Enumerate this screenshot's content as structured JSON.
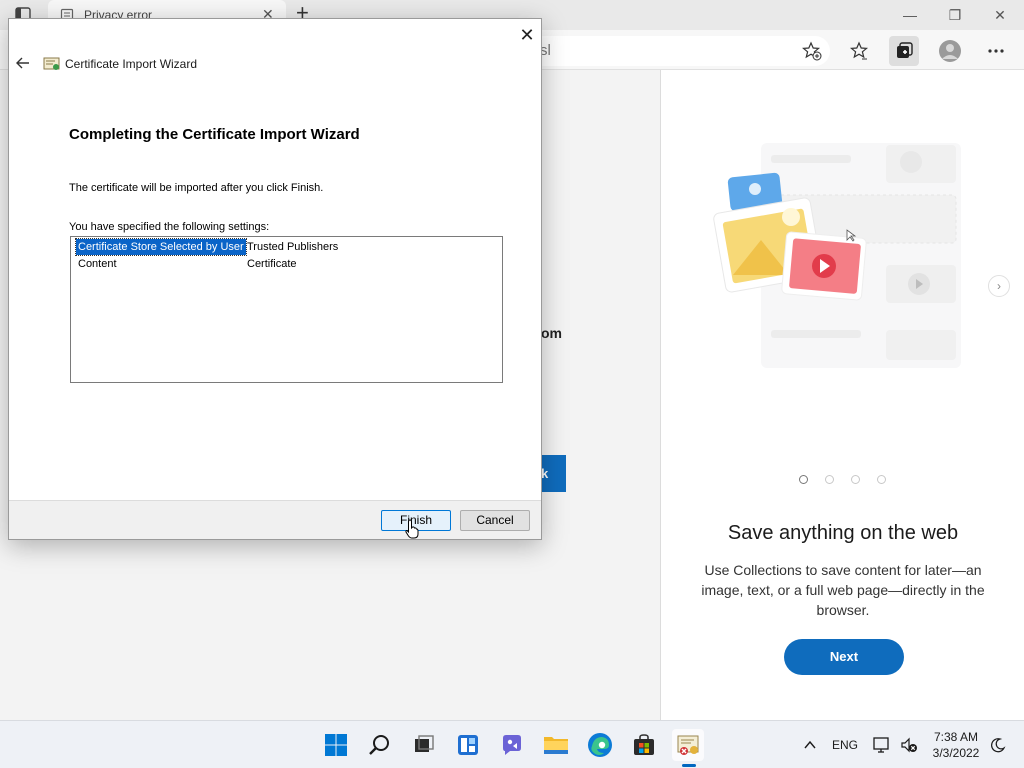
{
  "browser": {
    "tab_title": "Privacy error",
    "address_text": "sl"
  },
  "page": {
    "partial_heading": "om",
    "partial_button": "k"
  },
  "collections_pane": {
    "title": "Save anything on the web",
    "description": "Use Collections to save content for later—an image, text, or a full web page—directly in the browser.",
    "next_label": "Next",
    "carousel_count": 4,
    "carousel_active": 0
  },
  "dialog": {
    "window_title": "Certificate Import Wizard",
    "heading": "Completing the Certificate Import Wizard",
    "info": "The certificate will be imported after you click Finish.",
    "settings_label": "You have specified the following settings:",
    "settings": [
      {
        "key": "Certificate Store Selected by User",
        "value": "Trusted Publishers"
      },
      {
        "key": "Content",
        "value": "Certificate"
      }
    ],
    "finish_label": "Finish",
    "cancel_label": "Cancel"
  },
  "taskbar": {
    "language": "ENG",
    "time": "7:38 AM",
    "date": "3/3/2022"
  },
  "colors": {
    "accent": "#0f6cbd",
    "selection": "#0a64c8"
  }
}
